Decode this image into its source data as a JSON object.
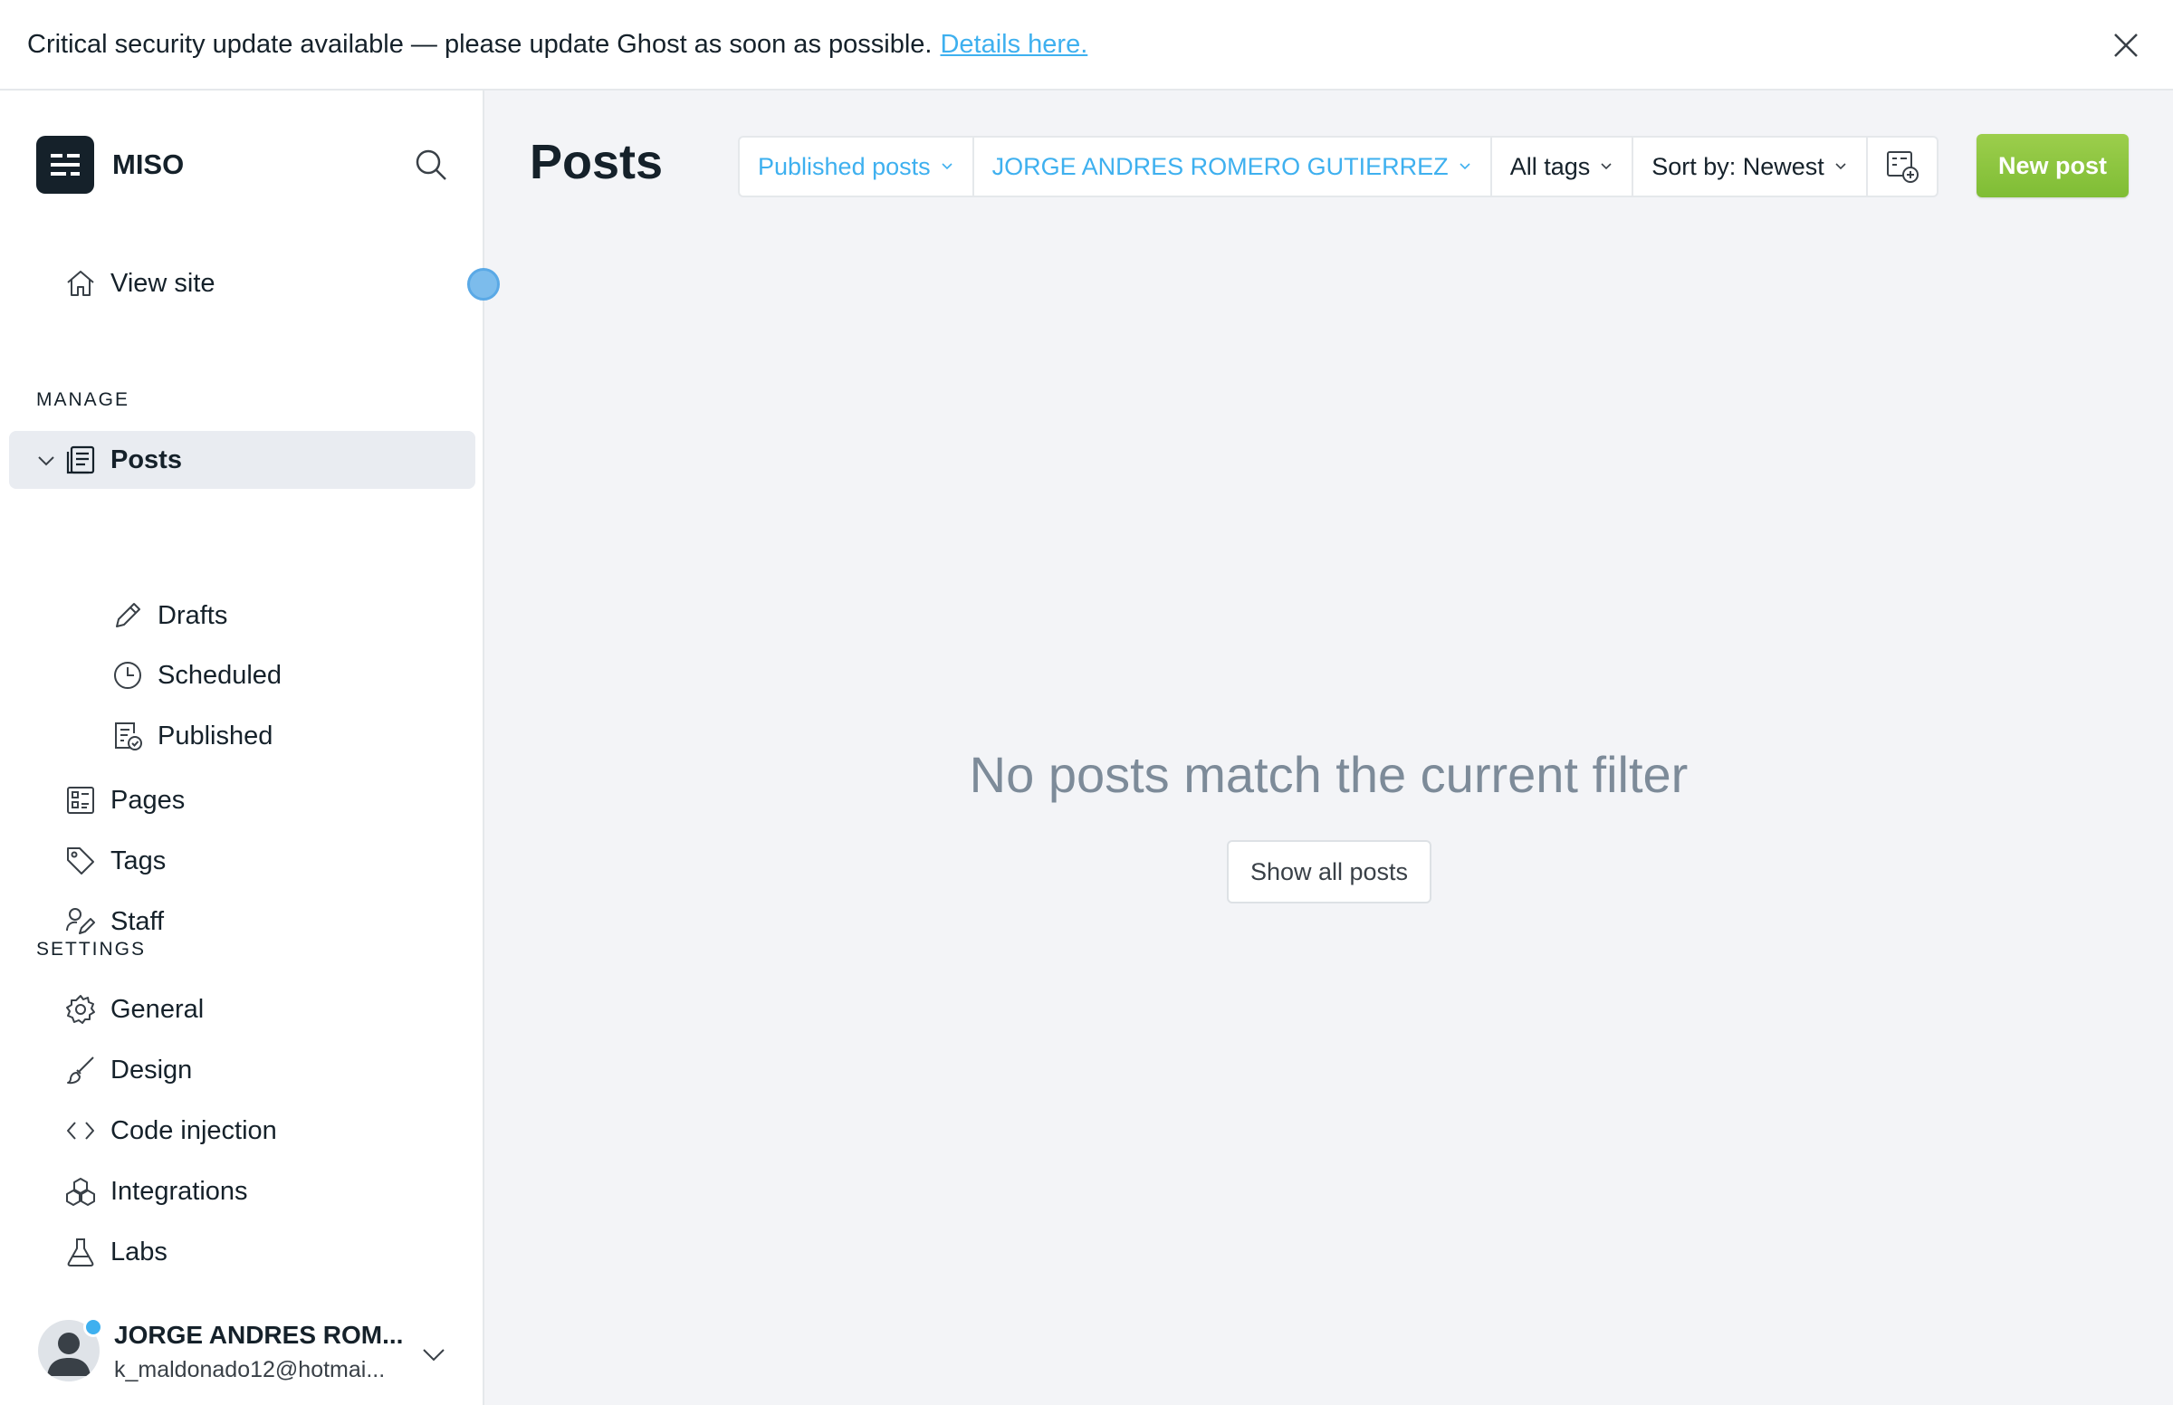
{
  "banner": {
    "message": "Critical security update available — please update Ghost as soon as possible.",
    "link_text": "Details here."
  },
  "sidebar": {
    "brand": "MISO",
    "view_site": "View site",
    "manage_title": "MANAGE",
    "posts": "Posts",
    "drafts": "Drafts",
    "scheduled": "Scheduled",
    "published": "Published",
    "pages": "Pages",
    "tags": "Tags",
    "staff": "Staff",
    "settings_title": "SETTINGS",
    "general": "General",
    "design": "Design",
    "code_injection": "Code injection",
    "integrations": "Integrations",
    "labs": "Labs"
  },
  "user": {
    "name": "JORGE ANDRES ROM...",
    "email": "k_maldonado12@hotmai..."
  },
  "main": {
    "title": "Posts",
    "filters": {
      "type": "Published posts",
      "author": "JORGE ANDRES ROMERO GUTIERREZ",
      "tags": "All tags",
      "sort": "Sort by: Newest"
    },
    "new_post": "New post",
    "empty_message": "No posts match the current filter",
    "show_all": "Show all posts"
  },
  "colors": {
    "accent_blue": "#3eb0ef",
    "green": "#8cc63f",
    "dark": "#15212a"
  }
}
